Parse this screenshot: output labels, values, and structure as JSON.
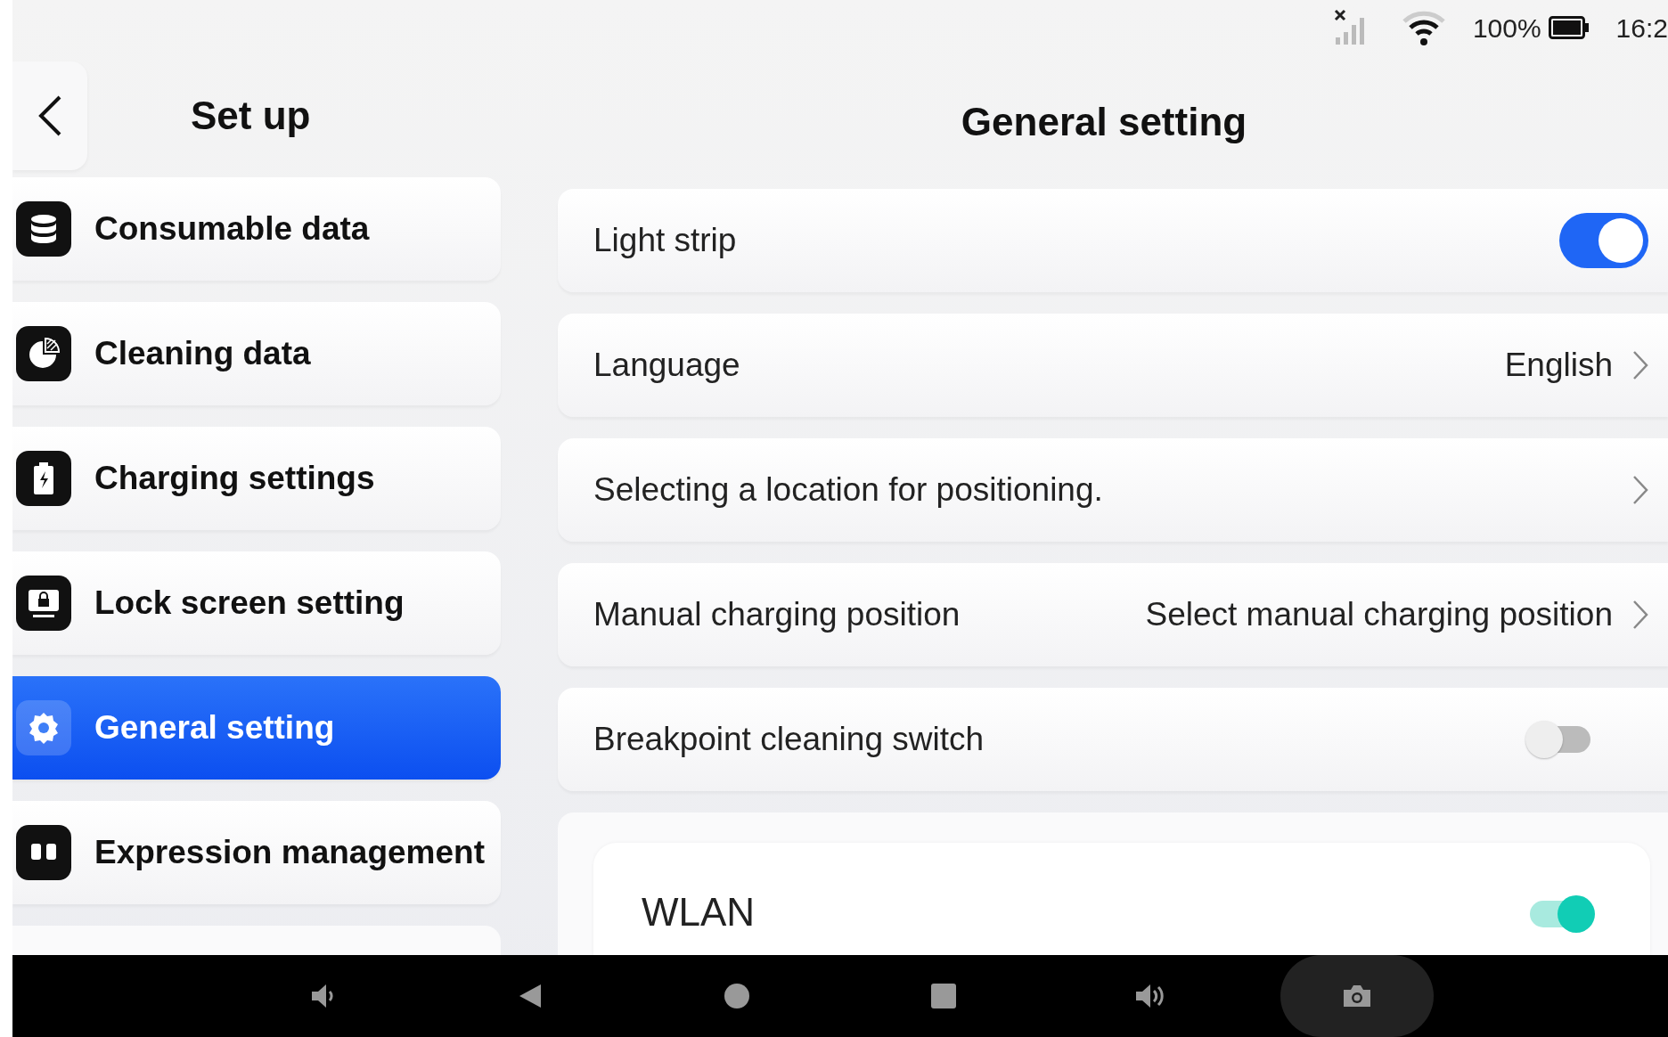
{
  "status_bar": {
    "battery": "100%",
    "time": "16:2"
  },
  "sidebar": {
    "title": "Set up",
    "items": [
      {
        "label": "Consumable data",
        "selected": false
      },
      {
        "label": "Cleaning data",
        "selected": false
      },
      {
        "label": "Charging settings",
        "selected": false
      },
      {
        "label": "Lock screen setting",
        "selected": false
      },
      {
        "label": "General setting",
        "selected": true
      },
      {
        "label": "Expression management",
        "selected": false
      }
    ]
  },
  "main": {
    "title": "General setting",
    "rows": [
      {
        "kind": "switch",
        "label": "Light strip",
        "on": true
      },
      {
        "kind": "link",
        "label": "Language",
        "value": "English"
      },
      {
        "kind": "link",
        "label": "Selecting a location for positioning."
      },
      {
        "kind": "link",
        "label": "Manual charging position",
        "value": "Select manual charging position"
      },
      {
        "kind": "switch",
        "label": "Breakpoint cleaning switch",
        "on": false
      }
    ],
    "wlan": {
      "label": "WLAN",
      "on": true
    }
  }
}
